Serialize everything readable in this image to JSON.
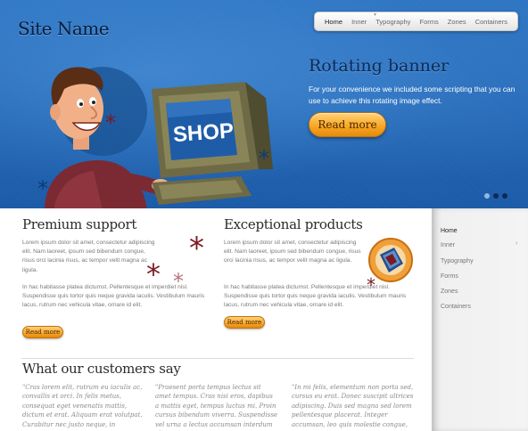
{
  "header": {
    "site_name": "Site Name",
    "nav": [
      {
        "label": "Home",
        "active": true
      },
      {
        "label": "Inner",
        "active": false
      },
      {
        "label": "Typography",
        "active": false
      },
      {
        "label": "Forms",
        "active": false
      },
      {
        "label": "Zones",
        "active": false
      },
      {
        "label": "Containers",
        "active": false
      }
    ]
  },
  "banner": {
    "title": "Rotating banner",
    "text": "For your convenience we included some scripting that you can use to achieve this rotating image effect.",
    "button_label": "Read more",
    "illustration_text": "SHOP",
    "slides_total": 3,
    "active_slide": 1
  },
  "features": [
    {
      "title": "Premium support",
      "para1": "Lorem ipsum dolor sit amet, consectetur adipiscing elit. Nam laoreet, ipsum sed bibendum congue, risus orci lacinia risus, ac tempor velit magna ac ligula.",
      "para2": "In hac habitasse platea dictumst. Pellentesque et imperdiet nisl. Suspendisse quis tortor quis neque gravida iaculis. Vestibulum mauris lacus, rutrum nec vehicula vitae, ornare id elit.",
      "button_label": "Read more"
    },
    {
      "title": "Exceptional products",
      "para1": "Lorem ipsum dolor sit amet, consectetur adipiscing elit. Nam laoreet, ipsum sed bibendum congue, risus orci lacinia risus, ac tempor velit magna ac ligula.",
      "para2": "In hac habitasse platea dictumst. Pellentesque et imperdiet nisl. Suspendisse quis tortor quis neque gravida iaculis. Vestibulum mauris lacus, rutrum nec vehicula vitae, ornare id elit.",
      "button_label": "Read more"
    }
  ],
  "customers": {
    "title": "What our customers say",
    "quotes": [
      "\"Cras lorem elit, rutrum eu iaculis ac, convallis et orci. In felis metus, consequat eget venenatis mattis, dictum et erat. Aliquam erat volutpat. Curabitur nec justo neque, in",
      "\"Praesent porta tempus lectus sit amet tempus. Cras nisi eros, dapibus a mattis eget, tempus luctus mi. Proin cursus bibendum viverra. Suspendisse vel urna a lectus accumsan interdum sit amet et",
      "\"In mi felis, elementum non porta sed, cursus eu erat. Donec suscipit ultrices adipiscing. Duis sed magna sed lorem pellentesque placerat. Integer accumsan, leo quis molestie congue,"
    ]
  },
  "sidebar": {
    "items": [
      {
        "label": "Home",
        "active": true
      },
      {
        "label": "Inner",
        "active": false,
        "has_children": true
      },
      {
        "label": "Typography",
        "active": false
      },
      {
        "label": "Forms",
        "active": false
      },
      {
        "label": "Zones",
        "active": false
      },
      {
        "label": "Containers",
        "active": false
      }
    ]
  },
  "colors": {
    "banner_blue": "#1d63b3",
    "button_orange": "#f9a825",
    "heading_dark": "#2b2b2b",
    "asterisk_red": "#7a1a22"
  }
}
